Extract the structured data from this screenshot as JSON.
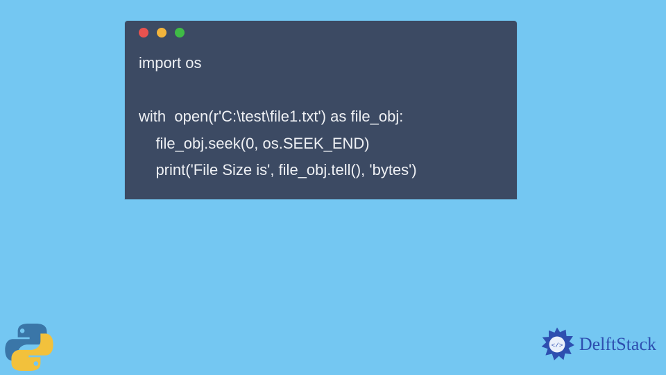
{
  "code": {
    "lines": [
      "import os",
      "",
      "with  open(r'C:\\test\\file1.txt') as file_obj:",
      "    file_obj.seek(0, os.SEEK_END)",
      "    print('File Size is', file_obj.tell(), 'bytes')"
    ]
  },
  "brand": {
    "name": "DelftStack"
  },
  "colors": {
    "page_bg": "#74c7f2",
    "window_bg": "#3c4a63",
    "code_fg": "#eef0f4",
    "dot_red": "#e9524f",
    "dot_yellow": "#f2b43c",
    "dot_green": "#3fbb46",
    "brand_blue": "#2d4fb0",
    "python_blue": "#3a76a8",
    "python_yellow": "#f2c13c"
  }
}
